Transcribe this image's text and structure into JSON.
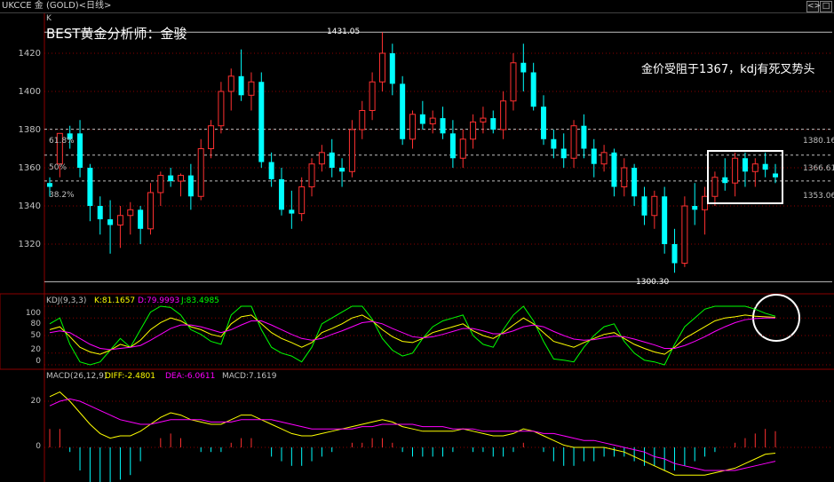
{
  "window": {
    "title": "UKCCE 金 (GOLD)<日线>",
    "buttons": [
      "<>",
      "□"
    ]
  },
  "overlay": {
    "analyst": "BEST黄金分析师：金骏",
    "comment": "金价受阻于1367，kdj有死叉势头",
    "marker_k": "K"
  },
  "price_levels": [
    {
      "label": "61.8%",
      "value": "1380.16"
    },
    {
      "label": "50%",
      "value": "1366.61"
    },
    {
      "label": "38.2%",
      "value": "1353.06"
    }
  ],
  "annotations": {
    "high": "1431.05",
    "low": "1300.30"
  },
  "kdj": {
    "title": "KDJ(9,3,3)",
    "k": "K:81.1657",
    "d": "D:79.9993",
    "j": "J:83.4985",
    "yticks": [
      "100",
      "80",
      "50",
      "20",
      "0"
    ]
  },
  "macd": {
    "title": "MACD(26,12,9)",
    "diff": "DIFF:-2.4801",
    "dea": "DEA:-6.0611",
    "macd": "MACD:7.1619",
    "yticks": [
      "20",
      "0"
    ]
  },
  "colors": {
    "up": "#ff3030",
    "down": "#00ffff",
    "k": "#ffffff",
    "d": "#ffff00",
    "j": "#ff00ff",
    "j_line": "#00ff00",
    "grid": "#8b0000"
  },
  "chart_data": {
    "type": "candlestick",
    "ylim": [
      1300,
      1430
    ],
    "yticks": [
      1320,
      1340,
      1360,
      1380,
      1400,
      1420
    ],
    "candles": [
      [
        1352,
        1355,
        1345,
        1350
      ],
      [
        1362,
        1368,
        1355,
        1378
      ],
      [
        1378,
        1382,
        1370,
        1375
      ],
      [
        1378,
        1385,
        1355,
        1360
      ],
      [
        1360,
        1362,
        1332,
        1340
      ],
      [
        1340,
        1345,
        1325,
        1333
      ],
      [
        1333,
        1343,
        1315,
        1330
      ],
      [
        1330,
        1340,
        1318,
        1335
      ],
      [
        1335,
        1342,
        1325,
        1338
      ],
      [
        1338,
        1340,
        1320,
        1328
      ],
      [
        1328,
        1352,
        1325,
        1347
      ],
      [
        1347,
        1358,
        1340,
        1356
      ],
      [
        1356,
        1360,
        1350,
        1353
      ],
      [
        1353,
        1357,
        1345,
        1356
      ],
      [
        1356,
        1362,
        1338,
        1345
      ],
      [
        1345,
        1375,
        1343,
        1370
      ],
      [
        1370,
        1385,
        1365,
        1382
      ],
      [
        1382,
        1405,
        1378,
        1400
      ],
      [
        1400,
        1412,
        1390,
        1408
      ],
      [
        1408,
        1422,
        1395,
        1398
      ],
      [
        1398,
        1410,
        1390,
        1405
      ],
      [
        1405,
        1410,
        1360,
        1363
      ],
      [
        1363,
        1368,
        1350,
        1354
      ],
      [
        1354,
        1360,
        1335,
        1338
      ],
      [
        1338,
        1348,
        1328,
        1336
      ],
      [
        1336,
        1355,
        1332,
        1350
      ],
      [
        1350,
        1365,
        1345,
        1362
      ],
      [
        1362,
        1372,
        1358,
        1368
      ],
      [
        1368,
        1375,
        1355,
        1360
      ],
      [
        1360,
        1365,
        1350,
        1358
      ],
      [
        1358,
        1385,
        1355,
        1380
      ],
      [
        1380,
        1395,
        1375,
        1390
      ],
      [
        1390,
        1410,
        1385,
        1405
      ],
      [
        1405,
        1431,
        1400,
        1420
      ],
      [
        1420,
        1425,
        1398,
        1404
      ],
      [
        1404,
        1408,
        1372,
        1375
      ],
      [
        1375,
        1390,
        1370,
        1388
      ],
      [
        1388,
        1395,
        1380,
        1383
      ],
      [
        1383,
        1390,
        1378,
        1386
      ],
      [
        1386,
        1392,
        1375,
        1378
      ],
      [
        1378,
        1385,
        1360,
        1365
      ],
      [
        1365,
        1380,
        1360,
        1375
      ],
      [
        1375,
        1388,
        1370,
        1384
      ],
      [
        1384,
        1392,
        1378,
        1386
      ],
      [
        1386,
        1390,
        1378,
        1380
      ],
      [
        1380,
        1400,
        1375,
        1395
      ],
      [
        1395,
        1420,
        1390,
        1415
      ],
      [
        1415,
        1425,
        1400,
        1410
      ],
      [
        1410,
        1415,
        1390,
        1392
      ],
      [
        1392,
        1398,
        1372,
        1375
      ],
      [
        1375,
        1380,
        1365,
        1370
      ],
      [
        1370,
        1378,
        1360,
        1365
      ],
      [
        1365,
        1385,
        1360,
        1382
      ],
      [
        1382,
        1388,
        1365,
        1370
      ],
      [
        1370,
        1375,
        1355,
        1362
      ],
      [
        1362,
        1372,
        1358,
        1368
      ],
      [
        1368,
        1370,
        1345,
        1350
      ],
      [
        1350,
        1365,
        1345,
        1360
      ],
      [
        1360,
        1362,
        1340,
        1345
      ],
      [
        1345,
        1350,
        1330,
        1335
      ],
      [
        1335,
        1348,
        1328,
        1345
      ],
      [
        1345,
        1350,
        1315,
        1320
      ],
      [
        1320,
        1328,
        1305,
        1310
      ],
      [
        1310,
        1345,
        1308,
        1340
      ],
      [
        1340,
        1352,
        1330,
        1338
      ],
      [
        1338,
        1350,
        1325,
        1345
      ],
      [
        1345,
        1358,
        1340,
        1355
      ],
      [
        1355,
        1365,
        1348,
        1352
      ],
      [
        1352,
        1368,
        1345,
        1365
      ],
      [
        1365,
        1368,
        1350,
        1358
      ],
      [
        1358,
        1365,
        1350,
        1362
      ],
      [
        1362,
        1368,
        1355,
        1359
      ],
      [
        1357,
        1362,
        1352,
        1355
      ]
    ],
    "kdj_k": [
      60,
      65,
      48,
      30,
      22,
      18,
      25,
      35,
      30,
      42,
      60,
      72,
      80,
      75,
      65,
      60,
      52,
      48,
      70,
      82,
      85,
      70,
      55,
      45,
      38,
      30,
      38,
      55,
      62,
      70,
      80,
      85,
      75,
      60,
      48,
      40,
      38,
      45,
      55,
      60,
      65,
      70,
      58,
      50,
      45,
      55,
      68,
      80,
      70,
      55,
      40,
      35,
      30,
      38,
      45,
      52,
      55,
      45,
      35,
      28,
      22,
      18,
      30,
      45,
      55,
      65,
      75,
      80,
      82,
      85,
      83,
      82,
      81
    ],
    "kdj_d": [
      55,
      58,
      55,
      45,
      35,
      28,
      26,
      28,
      30,
      33,
      42,
      52,
      62,
      68,
      68,
      65,
      60,
      55,
      60,
      68,
      75,
      75,
      68,
      60,
      52,
      45,
      42,
      45,
      52,
      58,
      65,
      72,
      74,
      70,
      62,
      55,
      48,
      46,
      48,
      52,
      57,
      62,
      62,
      58,
      53,
      53,
      58,
      65,
      68,
      65,
      57,
      50,
      44,
      42,
      43,
      46,
      49,
      48,
      44,
      39,
      34,
      28,
      28,
      33,
      40,
      48,
      57,
      65,
      72,
      77,
      79,
      80,
      80
    ],
    "kdj_j": [
      70,
      80,
      35,
      5,
      0,
      5,
      25,
      45,
      30,
      60,
      90,
      100,
      98,
      85,
      60,
      52,
      40,
      35,
      85,
      100,
      100,
      60,
      30,
      20,
      15,
      5,
      30,
      70,
      80,
      90,
      100,
      100,
      78,
      45,
      25,
      15,
      20,
      45,
      65,
      75,
      80,
      85,
      50,
      35,
      30,
      60,
      85,
      100,
      75,
      40,
      10,
      8,
      5,
      30,
      50,
      65,
      70,
      40,
      20,
      8,
      5,
      0,
      35,
      65,
      80,
      95,
      100,
      100,
      100,
      100,
      95,
      88,
      83
    ],
    "macd_diff": [
      22,
      24,
      20,
      15,
      10,
      6,
      4,
      5,
      5,
      7,
      10,
      13,
      15,
      14,
      12,
      11,
      10,
      10,
      12,
      14,
      14,
      12,
      10,
      8,
      6,
      5,
      5,
      6,
      7,
      8,
      9,
      10,
      11,
      12,
      11,
      9,
      8,
      7,
      7,
      7,
      7,
      8,
      7,
      6,
      5,
      5,
      6,
      8,
      7,
      5,
      3,
      1,
      0,
      0,
      0,
      0,
      -1,
      -2,
      -4,
      -6,
      -8,
      -10,
      -12,
      -12,
      -12,
      -12,
      -11,
      -10,
      -9,
      -7,
      -5,
      -3,
      -2.5
    ],
    "macd_dea": [
      18,
      20,
      21,
      20,
      18,
      16,
      14,
      12,
      11,
      10,
      10,
      11,
      12,
      12,
      12,
      12,
      11,
      11,
      11,
      12,
      12,
      12,
      12,
      11,
      10,
      9,
      8,
      8,
      8,
      8,
      8,
      9,
      9,
      10,
      10,
      10,
      10,
      9,
      9,
      9,
      8,
      8,
      8,
      7,
      7,
      7,
      7,
      7,
      7,
      6,
      6,
      5,
      4,
      3,
      3,
      2,
      1,
      0,
      -1,
      -2,
      -4,
      -5,
      -7,
      -8,
      -9,
      -10,
      -10,
      -10,
      -10,
      -9,
      -8,
      -7,
      -6
    ],
    "macd_hist": [
      8,
      8,
      -2,
      -10,
      -16,
      -20,
      -20,
      -14,
      -12,
      -6,
      0,
      4,
      6,
      4,
      0,
      -2,
      -2,
      -2,
      2,
      4,
      4,
      0,
      -4,
      -6,
      -8,
      -8,
      -6,
      -4,
      -2,
      0,
      2,
      2,
      4,
      4,
      2,
      -2,
      -4,
      -4,
      -4,
      -4,
      -2,
      0,
      -2,
      -2,
      -4,
      -4,
      -2,
      2,
      0,
      -2,
      -6,
      -8,
      -8,
      -6,
      -6,
      -4,
      -4,
      -4,
      -6,
      -8,
      -8,
      -10,
      -10,
      -8,
      -6,
      -4,
      -2,
      0,
      2,
      4,
      6,
      8,
      7
    ]
  }
}
